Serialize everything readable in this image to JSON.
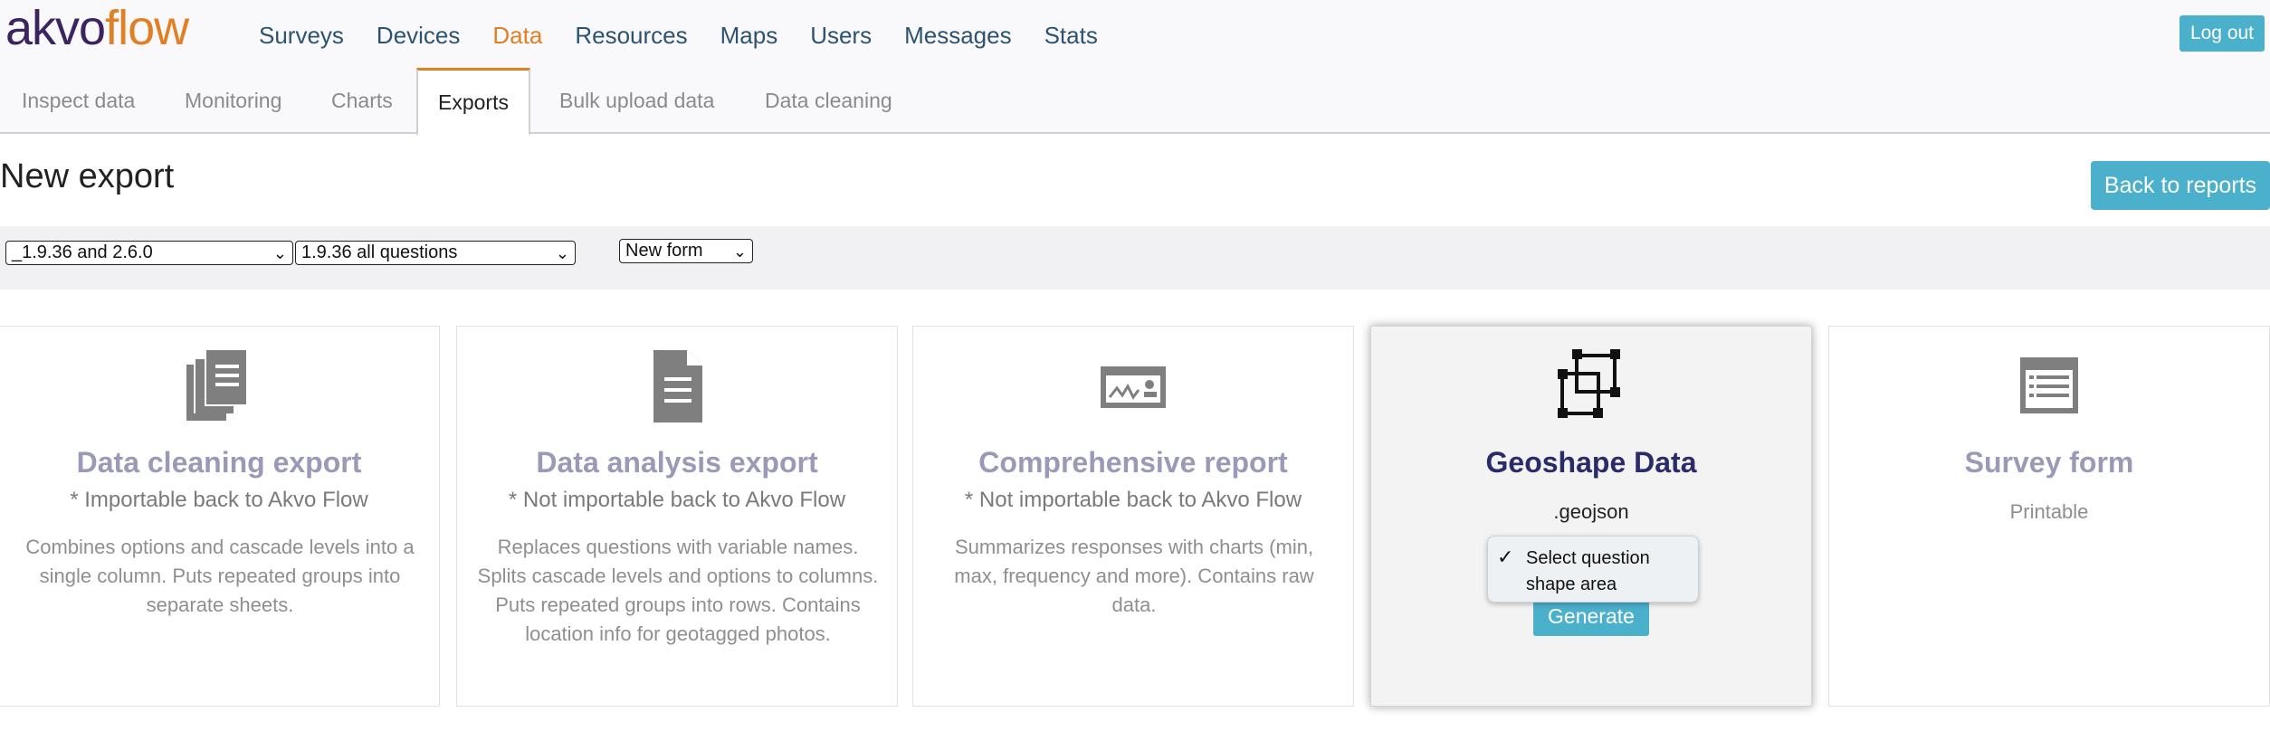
{
  "app": {
    "logo_part1": "akvo",
    "logo_part2": "flow",
    "brand_color": "#e07f24",
    "accent": "#4ab0cc"
  },
  "nav": {
    "items": [
      "Surveys",
      "Devices",
      "Data",
      "Resources",
      "Maps",
      "Users",
      "Messages",
      "Stats"
    ],
    "active": "Data",
    "logout_label": "Log out"
  },
  "subtabs": {
    "items": [
      "Inspect data",
      "Monitoring",
      "Charts",
      "Exports",
      "Bulk upload data",
      "Data cleaning"
    ],
    "active": "Exports"
  },
  "page": {
    "title": "New export",
    "back_label": "Back to reports"
  },
  "filters": {
    "survey_select": "_1.9.36 and 2.6.0",
    "form_select": "1.9.36 all questions",
    "type_select": "New form"
  },
  "cards": [
    {
      "title": "Data cleaning export",
      "note": "* Importable back to Akvo Flow",
      "desc": "Combines options and cascade levels into a single column. Puts repeated groups into separate sheets.",
      "icon": "documents-icon"
    },
    {
      "title": "Data analysis export",
      "note": "* Not importable back to Akvo Flow",
      "desc": "Replaces questions with variable names. Splits cascade levels and options to columns. Puts repeated groups into rows. Contains location info for geotagged photos.",
      "icon": "document-icon"
    },
    {
      "title": "Comprehensive report",
      "note": "* Not importable back to Akvo Flow",
      "desc": "Summarizes responses with charts (min, max, frequency and more). Contains raw data.",
      "icon": "chart-report-icon"
    },
    {
      "title": "Geoshape Data",
      "sub": ".geojson",
      "icon": "geoshape-icon",
      "generate_label": "Generate"
    },
    {
      "title": "Survey form",
      "sub": "Printable",
      "icon": "form-icon"
    }
  ],
  "dropdown": {
    "selected": "Select question shape area"
  }
}
